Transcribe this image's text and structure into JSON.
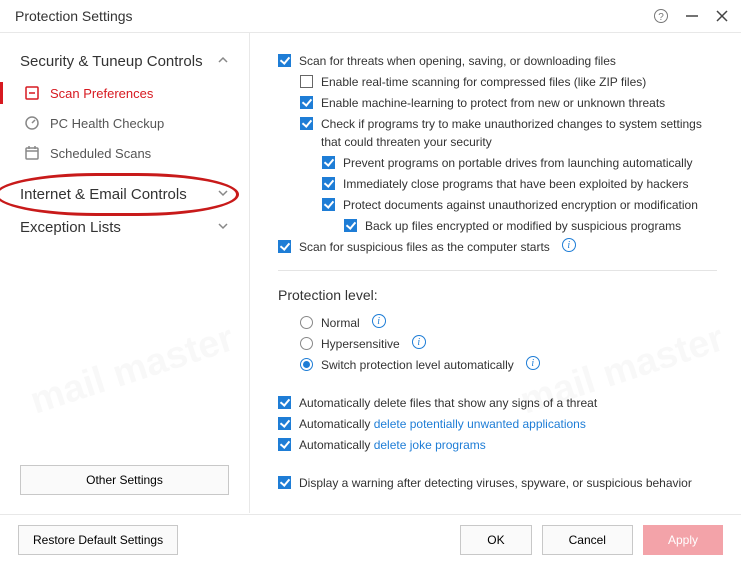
{
  "window": {
    "title": "Protection Settings"
  },
  "sidebar": {
    "sections": {
      "security": {
        "title": "Security & Tuneup Controls"
      },
      "internet": {
        "title": "Internet & Email Controls"
      },
      "exceptions": {
        "title": "Exception Lists"
      }
    },
    "items": {
      "scan_prefs": "Scan Preferences",
      "pc_health": "PC Health Checkup",
      "scheduled": "Scheduled Scans"
    },
    "other_settings": "Other Settings"
  },
  "opts": {
    "scan_threats": "Scan for threats when opening, saving, or downloading files",
    "realtime_zip": "Enable real-time scanning for compressed files (like ZIP files)",
    "ml_protect": "Enable machine-learning to protect from new or unknown threats",
    "check_unauth": "Check if programs try to make unauthorized changes to system settings that could threaten your security",
    "prevent_portable": "Prevent programs on portable drives from launching automatically",
    "close_exploited": "Immediately close programs that have been exploited by hackers",
    "protect_docs": "Protect documents against unauthorized encryption or modification",
    "backup_enc": "Back up files encrypted or modified by suspicious programs",
    "scan_startup": "Scan for suspicious files as the computer starts",
    "pl_title": "Protection level:",
    "pl_normal": "Normal",
    "pl_hyper": "Hypersensitive",
    "pl_auto": "Switch protection level automatically",
    "auto_del_threat": "Automatically delete files that show any signs of a threat",
    "auto_del_pua_pre": "Automatically ",
    "auto_del_pua_link": "delete potentially unwanted applications",
    "auto_del_joke_pre": "Automatically ",
    "auto_del_joke_link": "delete joke programs",
    "display_warning": "Display a warning after detecting viruses, spyware, or suspicious behavior"
  },
  "footer": {
    "restore": "Restore Default Settings",
    "ok": "OK",
    "cancel": "Cancel",
    "apply": "Apply"
  }
}
